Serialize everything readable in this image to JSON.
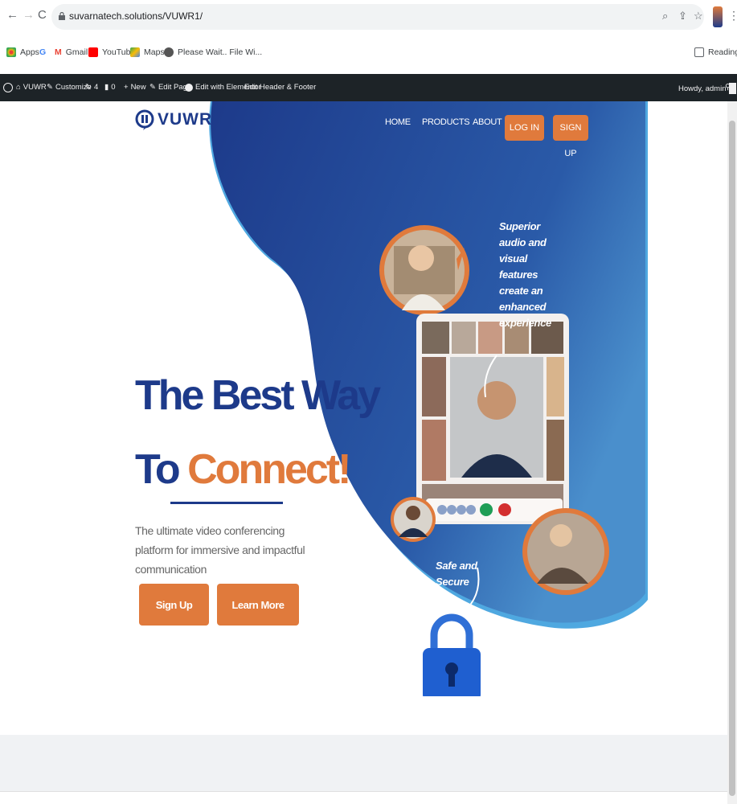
{
  "browser": {
    "url": "suvarnatech.solutions/VUWR1/",
    "bookmarks": [
      "Apps",
      "Gmail",
      "YouTube",
      "Maps",
      "Please Wait.. File Wi..."
    ],
    "reading_list": "Reading list"
  },
  "admin_bar": {
    "site": "VUWR",
    "customize": "Customize",
    "updates": "4",
    "comments": "0",
    "new": "New",
    "edit_page": "Edit Page",
    "elementor": "Edit with Elementor",
    "header_footer": "Edit Header & Footer",
    "howdy": "Howdy, admin"
  },
  "site": {
    "logo_text": "VUWR",
    "nav": [
      "HOME",
      "PRODUCTS",
      "ABOUT"
    ],
    "login": "LOG IN",
    "signup": "SIGN UP",
    "headline_line1": "The Best Way",
    "headline_to": "To ",
    "headline_accent": "Connect!",
    "subtext": "The ultimate video conferencing platform for immersive and impactful communication",
    "cta_primary": "Sign Up",
    "cta_secondary": "Learn More",
    "callout_top": "Superior audio and visual features create an enhanced experience",
    "callout_bottom": "Safe and Secure"
  },
  "colors": {
    "brand_blue": "#1d3a8a",
    "brand_orange": "#e07a3c"
  }
}
